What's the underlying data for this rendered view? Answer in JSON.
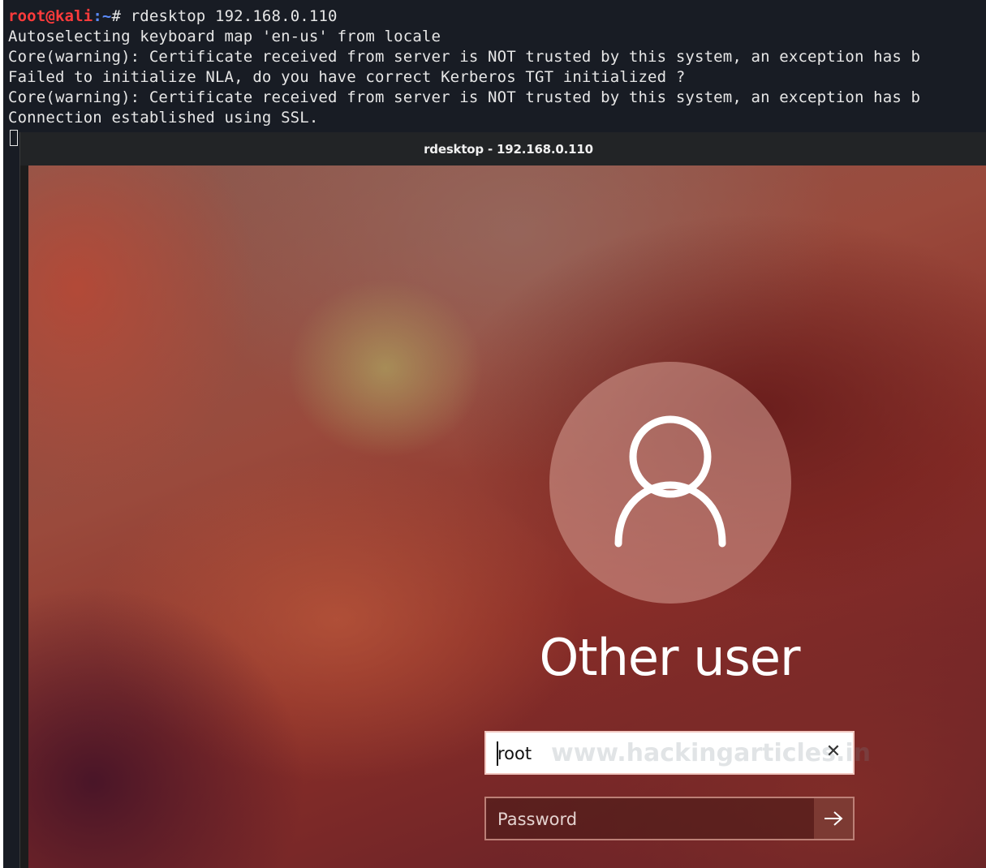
{
  "terminal": {
    "prompt_user": "root@kali",
    "prompt_path": ":~",
    "prompt_symbol": "# ",
    "command": "rdesktop 192.168.0.110",
    "output_lines": [
      "Autoselecting keyboard map 'en-us' from locale",
      "Core(warning): Certificate received from server is NOT trusted by this system, an exception has b",
      "Failed to initialize NLA, do you have correct Kerberos TGT initialized ?",
      "Core(warning): Certificate received from server is NOT trusted by this system, an exception has b",
      "Connection established using SSL."
    ]
  },
  "rdp_window": {
    "title": "rdesktop - 192.168.0.110"
  },
  "login": {
    "user_display_name": "Other user",
    "username_value": "root",
    "password_placeholder": "Password",
    "watermark": "www.hackingarticles.in",
    "clear_icon": "close-x-icon",
    "submit_icon": "arrow-right-icon",
    "avatar_icon": "user-silhouette-icon"
  },
  "colors": {
    "terminal_bg": "#181c24",
    "prompt_user": "#ff3b3b",
    "prompt_path": "#5b8cff",
    "terminal_text": "#e6e6e6"
  }
}
